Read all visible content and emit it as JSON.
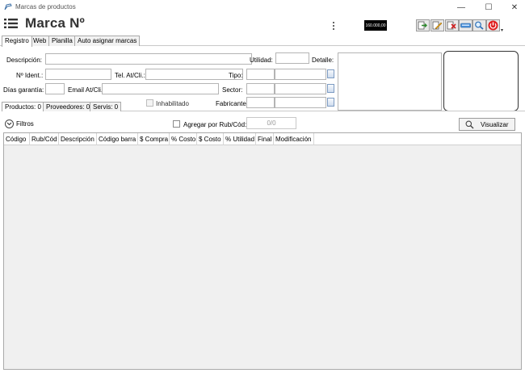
{
  "window": {
    "title": "Marcas de productos",
    "controls": {
      "minimize": "—",
      "maximize": "☐",
      "close": "✕"
    }
  },
  "header": {
    "title": "Marca Nº",
    "counter": "160.000,00"
  },
  "toolbar": {
    "icons": [
      "export-icon",
      "edit-icon",
      "delete-icon",
      "keyboard-icon",
      "search-icon",
      "power-icon"
    ],
    "dropdown_arrow": "▾"
  },
  "tabs": [
    {
      "label": "Registro",
      "active": true
    },
    {
      "label": "Web"
    },
    {
      "label": "Planilla"
    },
    {
      "label": "Auto asignar marcas"
    }
  ],
  "form": {
    "descripcion_label": "Descripción:",
    "utilidad_label": "Utilidad:",
    "detalle_label": "Detalle:",
    "nident_label": "Nº Ident.:",
    "tel_label": "Tel. At/Cli.:",
    "tipo_label": "Tipo:",
    "dias_label": "Días garantía:",
    "email_label": "Email At/Cli.:",
    "sector_label": "Sector:",
    "inhabilitado_label": "Inhabilitado",
    "fabricante_label": "Fabricante:"
  },
  "subtabs": [
    {
      "label": "Productos: 0",
      "active": true
    },
    {
      "label": "Proveedores: 0"
    },
    {
      "label": "Servis: 0"
    }
  ],
  "filters": {
    "label": "Filtros",
    "agregar_label": "Agregar por Rub/Cód:",
    "count": "0/0",
    "view_button": "Visualizar"
  },
  "grid": {
    "columns": [
      "Código",
      "Rub/Cód",
      "Descripción",
      "Código barra",
      "$ Compra",
      "% Costo",
      "$ Costo",
      "% Utilidad",
      "Final",
      "Modificación"
    ]
  }
}
